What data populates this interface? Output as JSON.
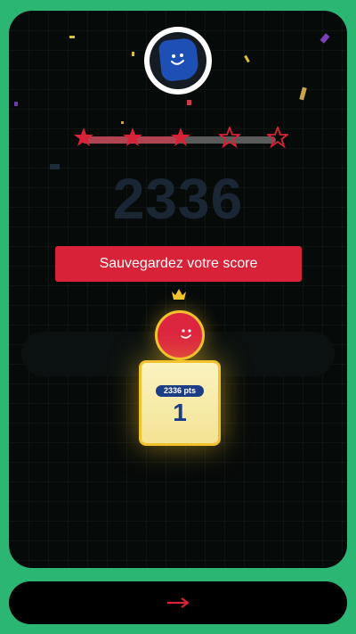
{
  "game": {
    "stars_earned": 3,
    "stars_total": 5,
    "score": "2336",
    "save_button_label": "Sauvegardez votre score"
  },
  "leaderboard": {
    "entry": {
      "points_label": "2336 pts",
      "rank": "1"
    }
  },
  "navigation": {
    "next_label": "→"
  },
  "colors": {
    "background": "#2bb673",
    "card": "#060a09",
    "accent_red": "#d72238",
    "gold": "#f2c22c",
    "rank_blue": "#1d3c86"
  },
  "icons": [
    "avatar-icon",
    "star-icon",
    "crown-icon",
    "arrow-right-icon"
  ]
}
